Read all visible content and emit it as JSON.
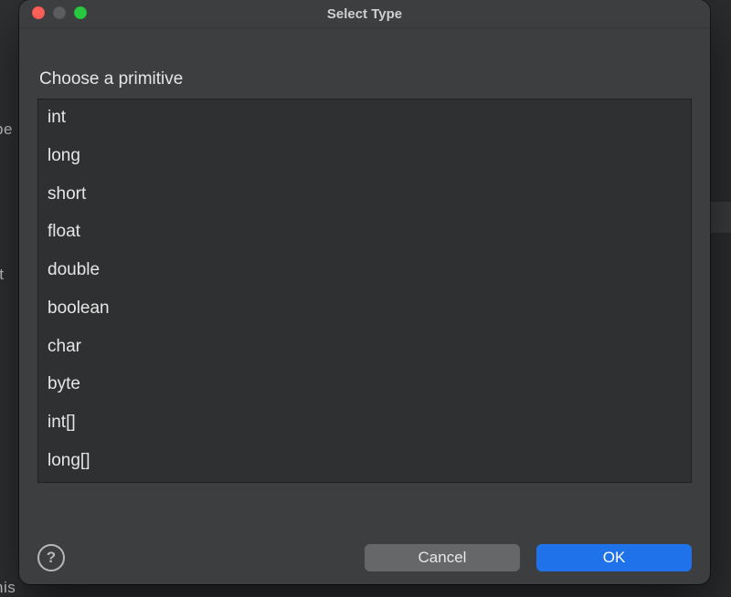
{
  "window": {
    "title": "Select Type"
  },
  "background_fragments": {
    "left1": "pe",
    "left2": "tt",
    "left3": "his"
  },
  "header": {
    "instruction": "Choose a primitive"
  },
  "list": [
    "int",
    "long",
    "short",
    "float",
    "double",
    "boolean",
    "char",
    "byte",
    "int[]",
    "long[]"
  ],
  "footer": {
    "cancel": "Cancel",
    "ok": "OK",
    "help_tooltip": "?"
  }
}
